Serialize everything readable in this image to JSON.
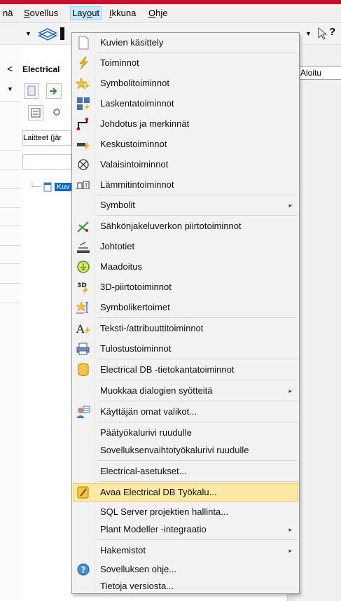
{
  "menubar": {
    "items": [
      {
        "pre": "",
        "u": "",
        "post": "nä"
      },
      {
        "pre": "",
        "u": "S",
        "post": "ovellus"
      },
      {
        "pre": "Lay",
        "u": "o",
        "post": "ut"
      },
      {
        "pre": "",
        "u": "I",
        "post": "kkuna"
      },
      {
        "pre": "",
        "u": "O",
        "post": "hje"
      }
    ]
  },
  "panel": {
    "title": "Electrical",
    "filter_value": "Laitteet (jär",
    "tree_node": "Kuv",
    "close_glyph": "<"
  },
  "right": {
    "tab_label": "Aloitu",
    "help_glyph": "?"
  },
  "menu": {
    "items": [
      {
        "label": "Kuvien käsittely",
        "icon": "blank-page-icon"
      },
      {
        "label": "Toiminnot",
        "icon": "lightning-icon"
      },
      {
        "label": "Symbolitoiminnot",
        "icon": "star-lightning-icon"
      },
      {
        "label": "Laskentatoiminnot",
        "icon": "calculator-icon"
      },
      {
        "label": "Johdotus ja merkinnät",
        "icon": "wiring-icon"
      },
      {
        "label": "Keskustoiminnot",
        "icon": "panel-icon"
      },
      {
        "label": "Valaisintoiminnot",
        "icon": "lamp-icon"
      },
      {
        "label": "Lämmitintoiminnot",
        "icon": "heater-icon"
      },
      {
        "label": "Symbolit",
        "icon": "",
        "submenu": true
      },
      {
        "label": "Sähkönjakeluverkon piirtotoiminnot",
        "icon": "distribution-icon"
      },
      {
        "label": "Johtotiet",
        "icon": "cable-tray-icon"
      },
      {
        "label": "Maadoitus",
        "icon": "ground-icon"
      },
      {
        "label": "3D-piirtotoiminnot",
        "icon": "3d-icon"
      },
      {
        "label": "Symbolikertoimet",
        "icon": "symbol-factor-icon"
      },
      {
        "label": "Teksti-/attribuuttitoiminnot",
        "icon": "text-icon"
      },
      {
        "label": "Tulostustoiminnot",
        "icon": "printer-icon"
      },
      {
        "label": "Electrical DB -tietokantatoiminnot",
        "icon": "database-icon"
      },
      {
        "label": "Muokkaa dialogien syötteitä",
        "icon": "",
        "submenu": true
      },
      {
        "label": "Käyttäjän omat valikot...",
        "icon": "user-menu-icon"
      },
      {
        "label": "Päätyökalurivi ruudulle",
        "icon": ""
      },
      {
        "label": "Sovelluksenvaihtotyökalurivi ruudulle",
        "icon": ""
      },
      {
        "label": "Electrical-asetukset...",
        "icon": ""
      },
      {
        "label": "Avaa Electrical DB Työkalu...",
        "icon": "db-tool-icon",
        "highlighted": true
      },
      {
        "label": "SQL Server projektien hallinta...",
        "icon": ""
      },
      {
        "label": "Plant Modeller -integraatio",
        "icon": "",
        "submenu": true
      },
      {
        "label": "Hakemistot",
        "icon": "",
        "submenu": true
      },
      {
        "label": "Sovelluksen ohje...",
        "icon": "help-icon"
      },
      {
        "label": "Tietoja versiosta...",
        "icon": ""
      }
    ],
    "submenu_glyph": "▸"
  },
  "colors": {
    "highlight": "#fbe9a4",
    "selection": "#0a64d6",
    "accent_bar": "#c8102e"
  }
}
